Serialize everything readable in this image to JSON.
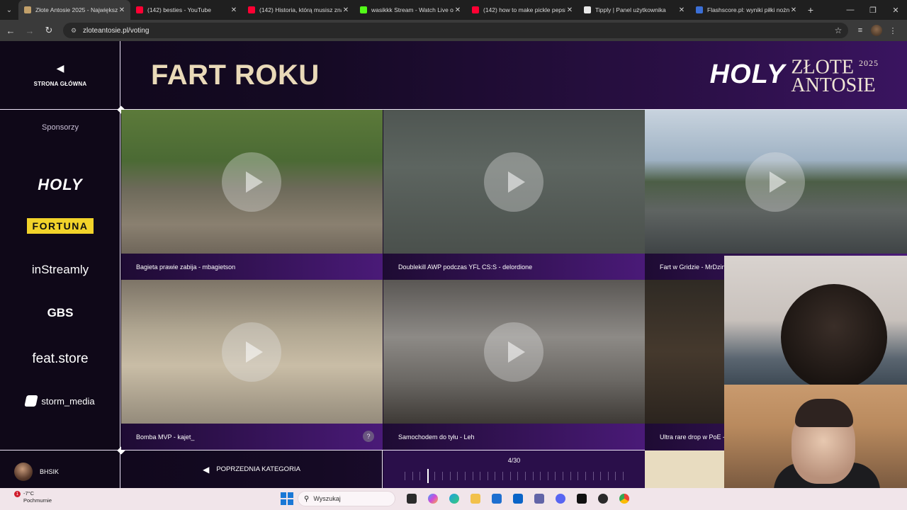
{
  "browser": {
    "tabs": [
      {
        "title": "Złote Antosie 2025 - Największ",
        "color": "#c2a06a",
        "active": true
      },
      {
        "title": "(142) besties - YouTube",
        "color": "#ff0033",
        "active": false
      },
      {
        "title": "(142) Historia, którą musisz zna",
        "color": "#ff0033",
        "active": false
      },
      {
        "title": "wasikkk Stream - Watch Live o",
        "color": "#53fc18",
        "active": false
      },
      {
        "title": "(142) how to make pickle pepsi",
        "color": "#ff0033",
        "active": false
      },
      {
        "title": "Tipply | Panel użytkownika",
        "color": "#e8e8e8",
        "active": false
      },
      {
        "title": "Flashscore.pl: wyniki piłki nożn",
        "color": "#3b6fd6",
        "active": false
      }
    ],
    "url": "zloteantosie.pl/voting"
  },
  "sidebar": {
    "back_label": "STRONA GŁÓWNA",
    "sponsors_title": "Sponsorzy",
    "sponsors": [
      "HOLY",
      "FORTUNA",
      "inStreamly",
      "GBS",
      "feat.store",
      "storm_media"
    ],
    "user": "BHSIK"
  },
  "header": {
    "category_title": "FART ROKU",
    "brand_holy": "HOLY",
    "brand_name_1": "ZŁOTE",
    "brand_name_2": "ANTOSIE",
    "brand_year": "2025"
  },
  "clips": [
    {
      "caption": "Bagieta prawie zabija - mbagietson"
    },
    {
      "caption": "Doublekill AWP podczas YFL CS:S - delordione"
    },
    {
      "caption": "Fart w Gridzie - MrDzinold"
    },
    {
      "caption": "Bomba MVP - kajet_"
    },
    {
      "caption": "Samochodem do tyłu - Leh"
    },
    {
      "caption": "Ultra rare drop w PoE - Pago"
    }
  ],
  "help_label": "?",
  "nav": {
    "prev_label": "POPRZEDNIA KATEGORIA"
  },
  "progress": {
    "label": "4/30",
    "current": 4,
    "total": 30
  },
  "taskbar": {
    "temp": "-7°C",
    "condition": "Pochmurnie",
    "weather_badge": "1",
    "search_placeholder": "Wyszukaj"
  }
}
